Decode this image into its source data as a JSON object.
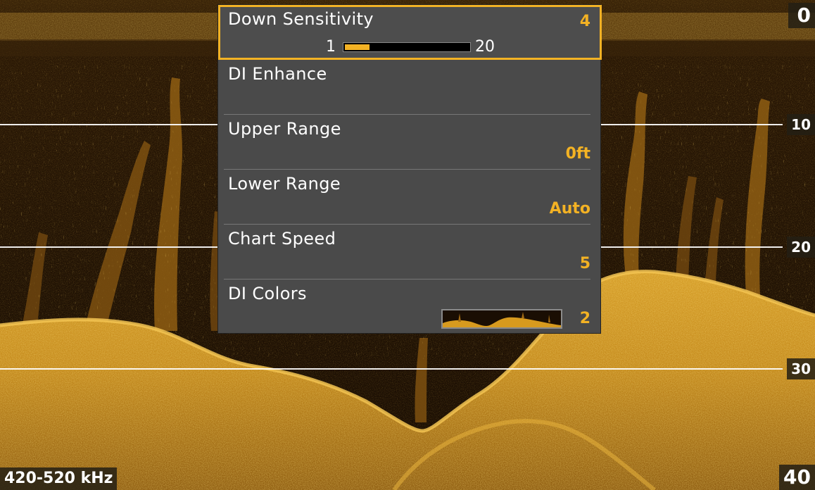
{
  "sonar": {
    "frequency_label": "420-520 kHz",
    "depth_scale": [
      "0",
      "10",
      "20",
      "30",
      "40"
    ],
    "color_theme": {
      "background": "#1b0f03",
      "echo": "#d79a1e",
      "bright_echo": "#f2c043"
    }
  },
  "menu": {
    "items": [
      {
        "label": "Down Sensitivity",
        "value": "4",
        "selected": true,
        "slider": {
          "min": "1",
          "max": "20",
          "level": 4
        }
      },
      {
        "label": "DI Enhance",
        "value": ""
      },
      {
        "label": "Upper Range",
        "value": "0ft"
      },
      {
        "label": "Lower Range",
        "value": "Auto"
      },
      {
        "label": "Chart Speed",
        "value": "5"
      },
      {
        "label": "DI Colors",
        "value": "2",
        "palette_icon": "amber-sonar-palette-swatch"
      }
    ],
    "accent_color": "#f3b224",
    "background_color": "#4a4a4a"
  }
}
